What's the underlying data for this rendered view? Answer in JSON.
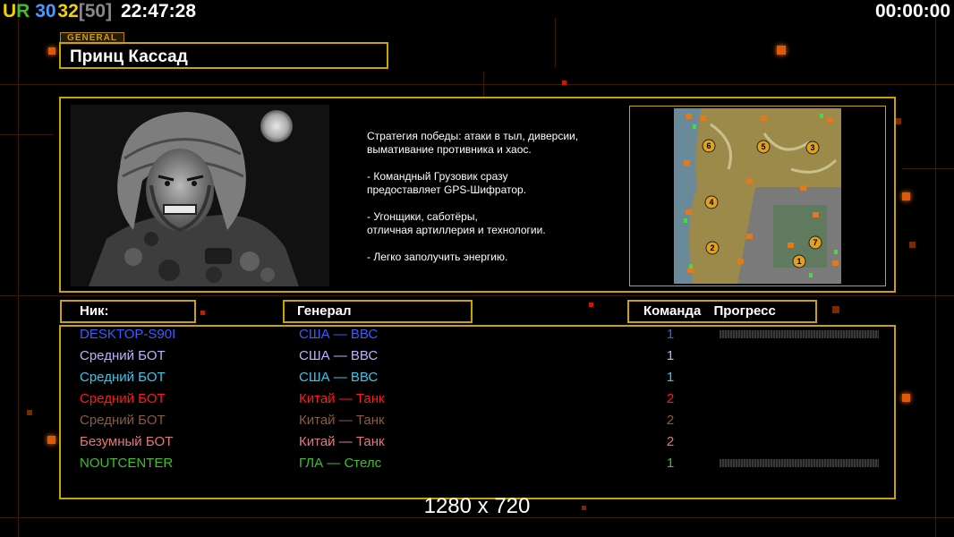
{
  "hud": {
    "tag_u": "U",
    "tag_r": "R",
    "fps": "30",
    "fps2": "32",
    "fps_limit": "[50]",
    "clock": "22:47:28",
    "timer": "00:00:00"
  },
  "general": {
    "tag": "GENERAL",
    "name": "Принц Кассад",
    "description": [
      "Стратегия победы: атаки в тыл, диверсии,\n вымативание противника и хаос.",
      "- Командный Грузовик сразу\nпредоставляет GPS-Шифратор.",
      "- Угонщики, саботёры,\nотличная артиллерия и технологии.",
      "- Легко заполучить энергию."
    ]
  },
  "map": {
    "slots": [
      "1",
      "2",
      "3",
      "4",
      "5",
      "6",
      "7"
    ]
  },
  "headers": {
    "nick": "Ник:",
    "general": "Генерал",
    "team": "Команда",
    "progress": "Прогресс"
  },
  "players": [
    {
      "nick": "DESKTOP-S90I",
      "general": "США — ВВС",
      "team": "1",
      "color": "#3a5cff",
      "progress": true
    },
    {
      "nick": "Средний БОТ",
      "general": "США — ВВС",
      "team": "1",
      "color": "#b9b3ff",
      "progress": false
    },
    {
      "nick": "Средний БОТ",
      "general": "США — ВВС",
      "team": "1",
      "color": "#35c7ec",
      "progress": false
    },
    {
      "nick": "Средний БОТ",
      "general": "Китай — Танк",
      "team": "2",
      "color": "#ff1a1a",
      "progress": false
    },
    {
      "nick": "Средний БОТ",
      "general": "Китай — Танк",
      "team": "2",
      "color": "#8a5a44",
      "progress": false
    },
    {
      "nick": "Безумный БОТ",
      "general": "Китай — Танк",
      "team": "2",
      "color": "#e07a7a",
      "progress": false
    },
    {
      "nick": "NOUTCENTER",
      "general": "ГЛА — Стелс",
      "team": "1",
      "color": "#3fbf2a",
      "progress": true
    }
  ],
  "resolution": "1280 x 720",
  "colors": {
    "accent_gold": "#c9a300",
    "bg_orange": "#e0580a"
  }
}
